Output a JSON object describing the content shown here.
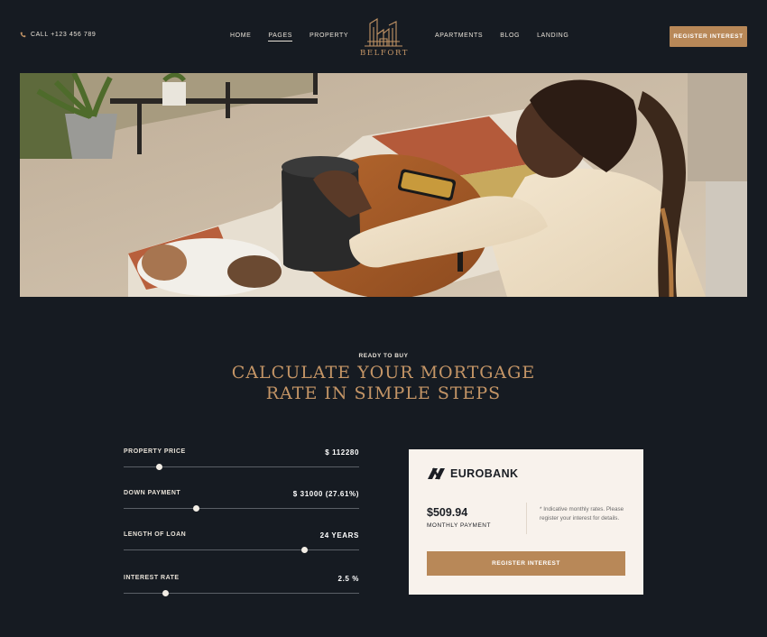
{
  "header": {
    "call_text": "CALL +123 456 789",
    "nav_left": [
      "HOME",
      "PAGES",
      "PROPERTY"
    ],
    "nav_right": [
      "APARTMENTS",
      "BLOG",
      "LANDING"
    ],
    "active_nav": "PAGES",
    "logo_text": "BELFORT",
    "register_label": "REGISTER INTEREST"
  },
  "hero": {
    "image_subject": "woman-with-smart-speaker-living-room"
  },
  "section": {
    "eyebrow": "READY TO BUY",
    "title_line1": "CALCULATE YOUR MORTGAGE",
    "title_line2": "RATE IN SIMPLE STEPS"
  },
  "calculator": {
    "rows": [
      {
        "label": "PROPERTY PRICE",
        "value": "$ 112280",
        "level": 0.15
      },
      {
        "label": "DOWN PAYMENT",
        "value": "$ 31000 (27.61%)",
        "level": 0.31
      },
      {
        "label": "LENGTH OF LOAN",
        "value": "24 YEARS",
        "level": 0.77
      },
      {
        "label": "INTEREST RATE",
        "value": "2.5 %",
        "level": 0.18
      }
    ]
  },
  "card": {
    "bank_name": "EUROBANK",
    "amount": "$509.94",
    "amount_label": "MONTHLY PAYMENT",
    "note": "* Indicative monthly rates. Please register your interest for details.",
    "register_label": "REGISTER INTEREST"
  },
  "colors": {
    "background": "#161b22",
    "accent": "#b88858",
    "accent_text": "#c49566",
    "card_bg": "#f8f2ec"
  },
  "icons": {
    "phone": "phone-icon",
    "logo": "building-logo-icon",
    "bank": "eurobank-logo-icon"
  }
}
